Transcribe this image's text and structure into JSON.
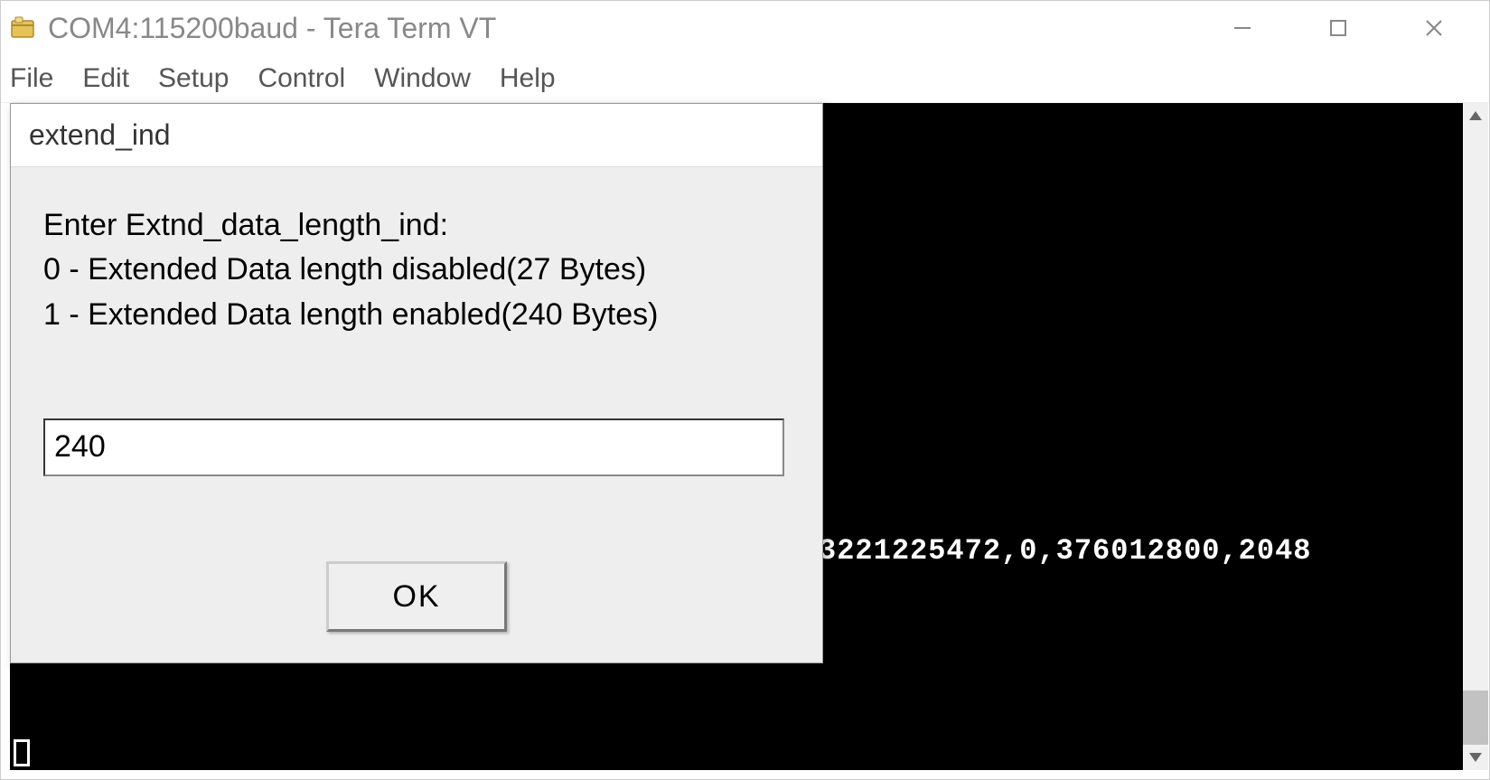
{
  "window": {
    "title": "COM4:115200baud - Tera Term VT"
  },
  "menubar": {
    "items": [
      "File",
      "Edit",
      "Setup",
      "Control",
      "Window",
      "Help"
    ]
  },
  "terminal": {
    "visible_line": "3221225472,0,376012800,2048"
  },
  "dialog": {
    "title": "extend_ind",
    "message_line1": "Enter Extnd_data_length_ind:",
    "message_line2": " 0 - Extended Data length disabled(27 Bytes)",
    "message_line3": " 1 - Extended Data length enabled(240 Bytes)",
    "input_value": "240",
    "ok_label": "OK"
  }
}
